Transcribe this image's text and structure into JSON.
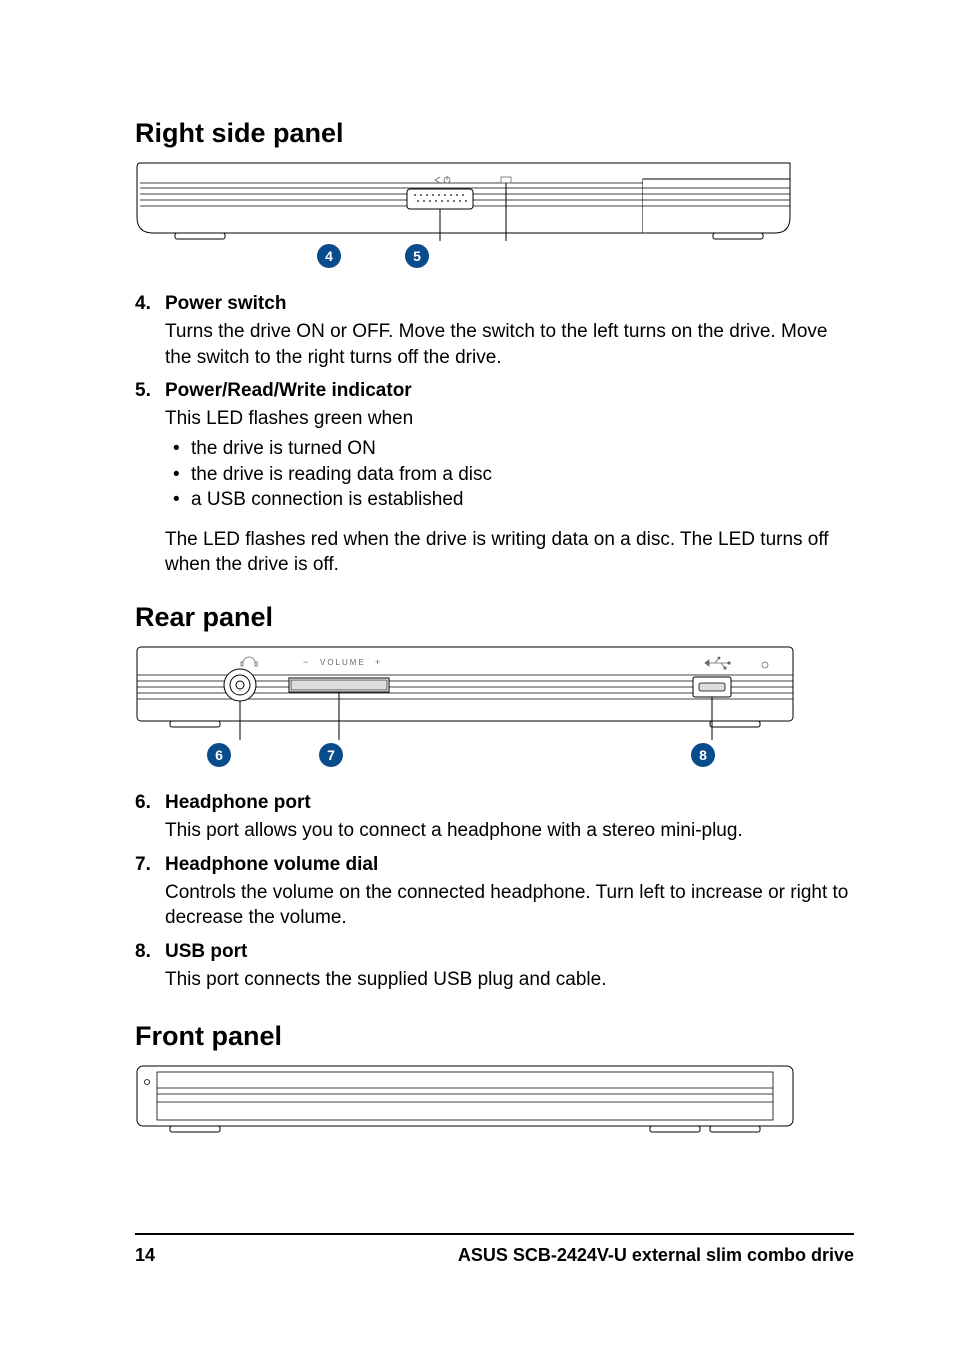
{
  "sections": {
    "right": {
      "title": "Right side panel",
      "callouts": [
        "4",
        "5"
      ],
      "items": [
        {
          "num": "4.",
          "title": "Power switch",
          "desc": "Turns the drive ON or OFF. Move the switch to the left turns on the drive. Move the switch to the right turns off the drive."
        },
        {
          "num": "5.",
          "title": "Power/Read/Write indicator",
          "desc": "This LED flashes green when",
          "bullets": [
            "the drive is turned ON",
            "the drive is reading data from a disc",
            "a USB connection is established"
          ],
          "after": "The LED flashes red when the drive is writing data on a disc. The LED turns off when the drive is off."
        }
      ]
    },
    "rear": {
      "title": "Rear panel",
      "rear_label": "VOLUME",
      "callouts": [
        "6",
        "7",
        "8"
      ],
      "items": [
        {
          "num": "6.",
          "title": "Headphone port",
          "desc": "This port allows you to connect a headphone with a stereo mini-plug."
        },
        {
          "num": "7.",
          "title": "Headphone volume dial",
          "desc": "Controls the volume on the connected headphone. Turn left to increase or right to decrease the volume."
        },
        {
          "num": "8.",
          "title": "USB port",
          "desc": "This port connects the supplied USB plug and cable."
        }
      ]
    },
    "front": {
      "title": "Front panel"
    }
  },
  "footer": {
    "page": "14",
    "text": "ASUS SCB-2424V-U external slim combo drive"
  }
}
